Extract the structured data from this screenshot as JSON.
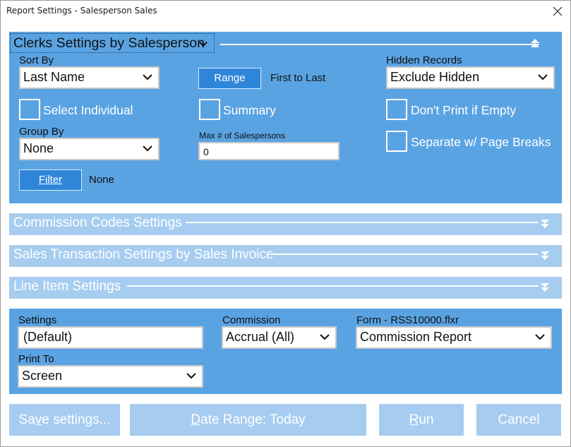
{
  "window": {
    "title": "Report Settings - Salesperson Sales"
  },
  "sections": {
    "clerks": {
      "title": "Clerks Settings by Salesperson"
    },
    "commission_codes": {
      "title": "Commission Codes Settings"
    },
    "sales_transaction": {
      "title": "Sales Transaction Settings by Sales Invoice"
    },
    "line_item": {
      "title": "Line Item Settings"
    }
  },
  "clerks": {
    "sort_by": {
      "label": "Sort By",
      "value": "Last Name"
    },
    "range": {
      "button": "Range",
      "value": "First to Last"
    },
    "hidden_records": {
      "label": "Hidden Records",
      "value": "Exclude Hidden"
    },
    "select_individual": {
      "label": "Select Individual",
      "checked": false
    },
    "summary": {
      "label": "Summary",
      "checked": false
    },
    "dont_print_if_empty": {
      "label": "Don't Print if Empty",
      "checked": false
    },
    "group_by": {
      "label": "Group By",
      "value": "None"
    },
    "max_salespersons": {
      "label": "Max # of Salespersons",
      "value": "0"
    },
    "separate_page_breaks": {
      "label": "Separate w/ Page Breaks",
      "checked": false
    },
    "filter": {
      "button": "Filter",
      "value": "None"
    }
  },
  "output": {
    "settings": {
      "label": "Settings",
      "value": "(Default)"
    },
    "commission": {
      "label": "Commission",
      "value": "Accrual (All)"
    },
    "form": {
      "label": "Form - RSS10000.flxr",
      "value": "Commission Report"
    },
    "print_to": {
      "label": "Print To",
      "value": "Screen"
    }
  },
  "footer": {
    "save_prefix": "Sa",
    "save_mnemonic": "v",
    "save_suffix": "e settings...",
    "date_mnemonic": "D",
    "date_suffix": "ate Range: Today",
    "run_mnemonic": "R",
    "run_suffix": "un",
    "cancel": "Cancel"
  },
  "colors": {
    "panel_active": "#5aa3e3",
    "panel_inactive": "#a6cdf0",
    "button_active": "#2f86d9"
  }
}
